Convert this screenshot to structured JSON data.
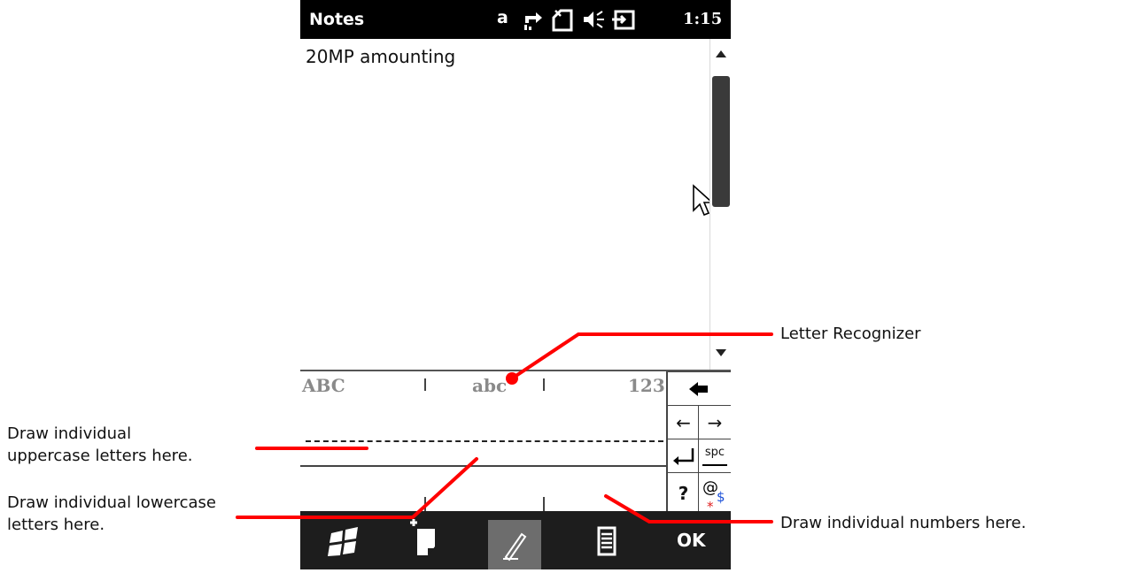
{
  "status_bar": {
    "app_title": "Notes",
    "input_indicator": "a",
    "time": "1:15",
    "icons": [
      "data-sync-icon",
      "signal-off-icon",
      "volume-icon",
      "battery-charging-icon"
    ]
  },
  "note": {
    "text": "20MP amounting"
  },
  "recognizer": {
    "modes": [
      "ABC",
      "abc",
      "123"
    ],
    "keys": {
      "backspace": "backspace-icon",
      "left": "←",
      "right": "→",
      "enter": "enter-icon",
      "space": "spc",
      "question": "?",
      "symbols": "@$*"
    }
  },
  "taskbar": {
    "start": "windows-start-icon",
    "new_note": "new-note-icon",
    "pen": "pen-icon",
    "menu": "menu-icon",
    "ok_label": "OK"
  },
  "annotations": {
    "letter_recognizer": "Letter Recognizer",
    "uppercase_line1": "Draw individual",
    "uppercase_line2": "uppercase letters here.",
    "lowercase_line1": "Draw individual lowercase",
    "lowercase_line2": "letters here.",
    "numbers": "Draw individual numbers here."
  },
  "colors": {
    "annotation_red": "#ff0000",
    "status_bar_bg": "#000000",
    "taskbar_bg": "#1d1d1d"
  }
}
